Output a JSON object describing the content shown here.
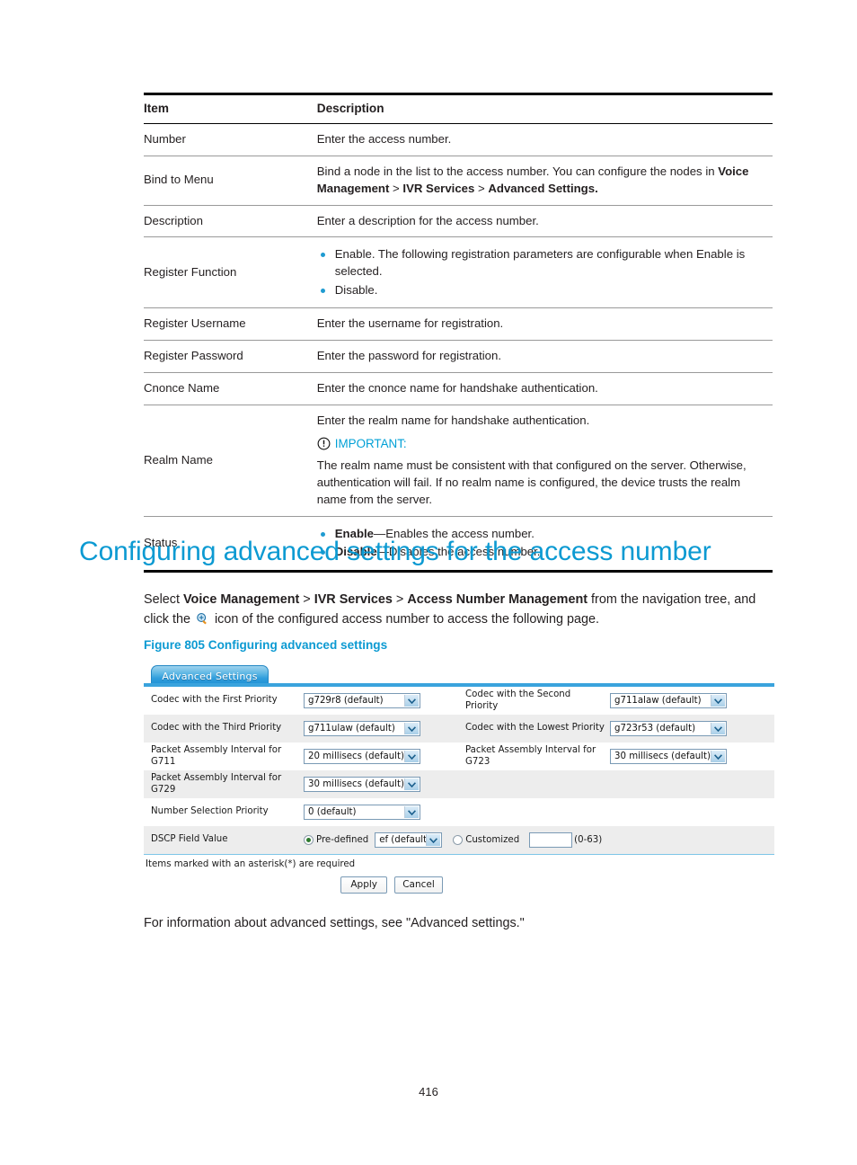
{
  "table": {
    "headers": [
      "Item",
      "Description"
    ],
    "rows": [
      {
        "item": "Number",
        "desc_plain": "Enter the access number."
      },
      {
        "item": "Bind to Menu",
        "desc_rich": [
          {
            "t": "Bind a node in the list to the access number. You can configure the nodes in "
          },
          {
            "t": "Voice Management",
            "b": true
          },
          {
            "t": " > "
          },
          {
            "t": "IVR Services",
            "b": true
          },
          {
            "t": " > "
          },
          {
            "t": "Advanced Settings.",
            "b": true
          }
        ]
      },
      {
        "item": "Description",
        "desc_plain": "Enter a description for the access number."
      },
      {
        "item": "Register Function",
        "bullets": [
          "Enable. The following registration parameters are configurable when Enable is selected.",
          "Disable."
        ]
      },
      {
        "item": "Register Username",
        "desc_plain": "Enter the username for registration."
      },
      {
        "item": "Register Password",
        "desc_plain": "Enter the password for registration."
      },
      {
        "item": "Cnonce Name",
        "desc_plain": "Enter the cnonce name for handshake authentication."
      },
      {
        "item": "Realm Name",
        "lead": "Enter the realm name for handshake authentication.",
        "important_label": "IMPORTANT:",
        "important_body": "The realm name must be consistent with that configured on the server. Otherwise, authentication will fail. If no realm name is configured, the device trusts the realm name from the server."
      },
      {
        "item": "Status",
        "bullets_rich": [
          [
            {
              "t": "Enable",
              "b": true
            },
            {
              "t": "—Enables the access number."
            }
          ],
          [
            {
              "t": "Disable",
              "b": true
            },
            {
              "t": "—Disables the access number."
            }
          ]
        ]
      }
    ]
  },
  "heading": "Configuring advanced settings for the access number",
  "intro": {
    "p1_a": "Select ",
    "nav1": "Voice Management",
    "sep1": " > ",
    "nav2": "IVR Services",
    "sep2": " > ",
    "nav3": "Access Number Management",
    "p1_b": " from the navigation tree, and click the ",
    "p1_c": " icon of the configured access number to access the following page.",
    "magnifier_icon": "magnifier-plus-icon"
  },
  "figure_caption": "Figure 805 Configuring advanced settings",
  "ui": {
    "tab_label": "Advanced Settings",
    "rows": [
      {
        "left_label": "Codec with the First Priority",
        "left_value": "g729r8 (default)",
        "right_label": "Codec with the Second Priority",
        "right_value": "g711alaw (default)"
      },
      {
        "left_label": "Codec with the Third Priority",
        "left_value": "g711ulaw (default)",
        "right_label": "Codec with the Lowest Priority",
        "right_value": "g723r53 (default)"
      },
      {
        "left_label": "Packet Assembly Interval for G711",
        "left_value": "20 millisecs (default)",
        "right_label": "Packet Assembly Interval for G723",
        "right_value": "30 millisecs (default)"
      },
      {
        "left_label": "Packet Assembly Interval for G729",
        "left_value": "30 millisecs (default)",
        "right_label": "",
        "right_value": ""
      },
      {
        "left_label": "Number Selection Priority",
        "left_value": "0 (default)",
        "right_label": "",
        "right_value": ""
      }
    ],
    "dscp": {
      "label": "DSCP Field Value",
      "predefined_label": "Pre-defined",
      "predefined_selected": true,
      "predefined_value": "ef (default",
      "customized_label": "Customized",
      "customized_selected": false,
      "customized_value": "",
      "range_hint": "(0-63)"
    },
    "required_note": "Items marked with an asterisk(*) are required",
    "apply_label": "Apply",
    "cancel_label": "Cancel"
  },
  "closing": "For information about advanced settings, see \"Advanced settings.\"",
  "page_number": "416",
  "colors": {
    "heading_blue": "#0c9ad2",
    "bullet_blue": "#1f9bd1",
    "important_blue": "#00a0d6",
    "tab_blue": "#2f9ddc",
    "panel_line": "#3aa3dd",
    "row_alt": "#ededed"
  }
}
